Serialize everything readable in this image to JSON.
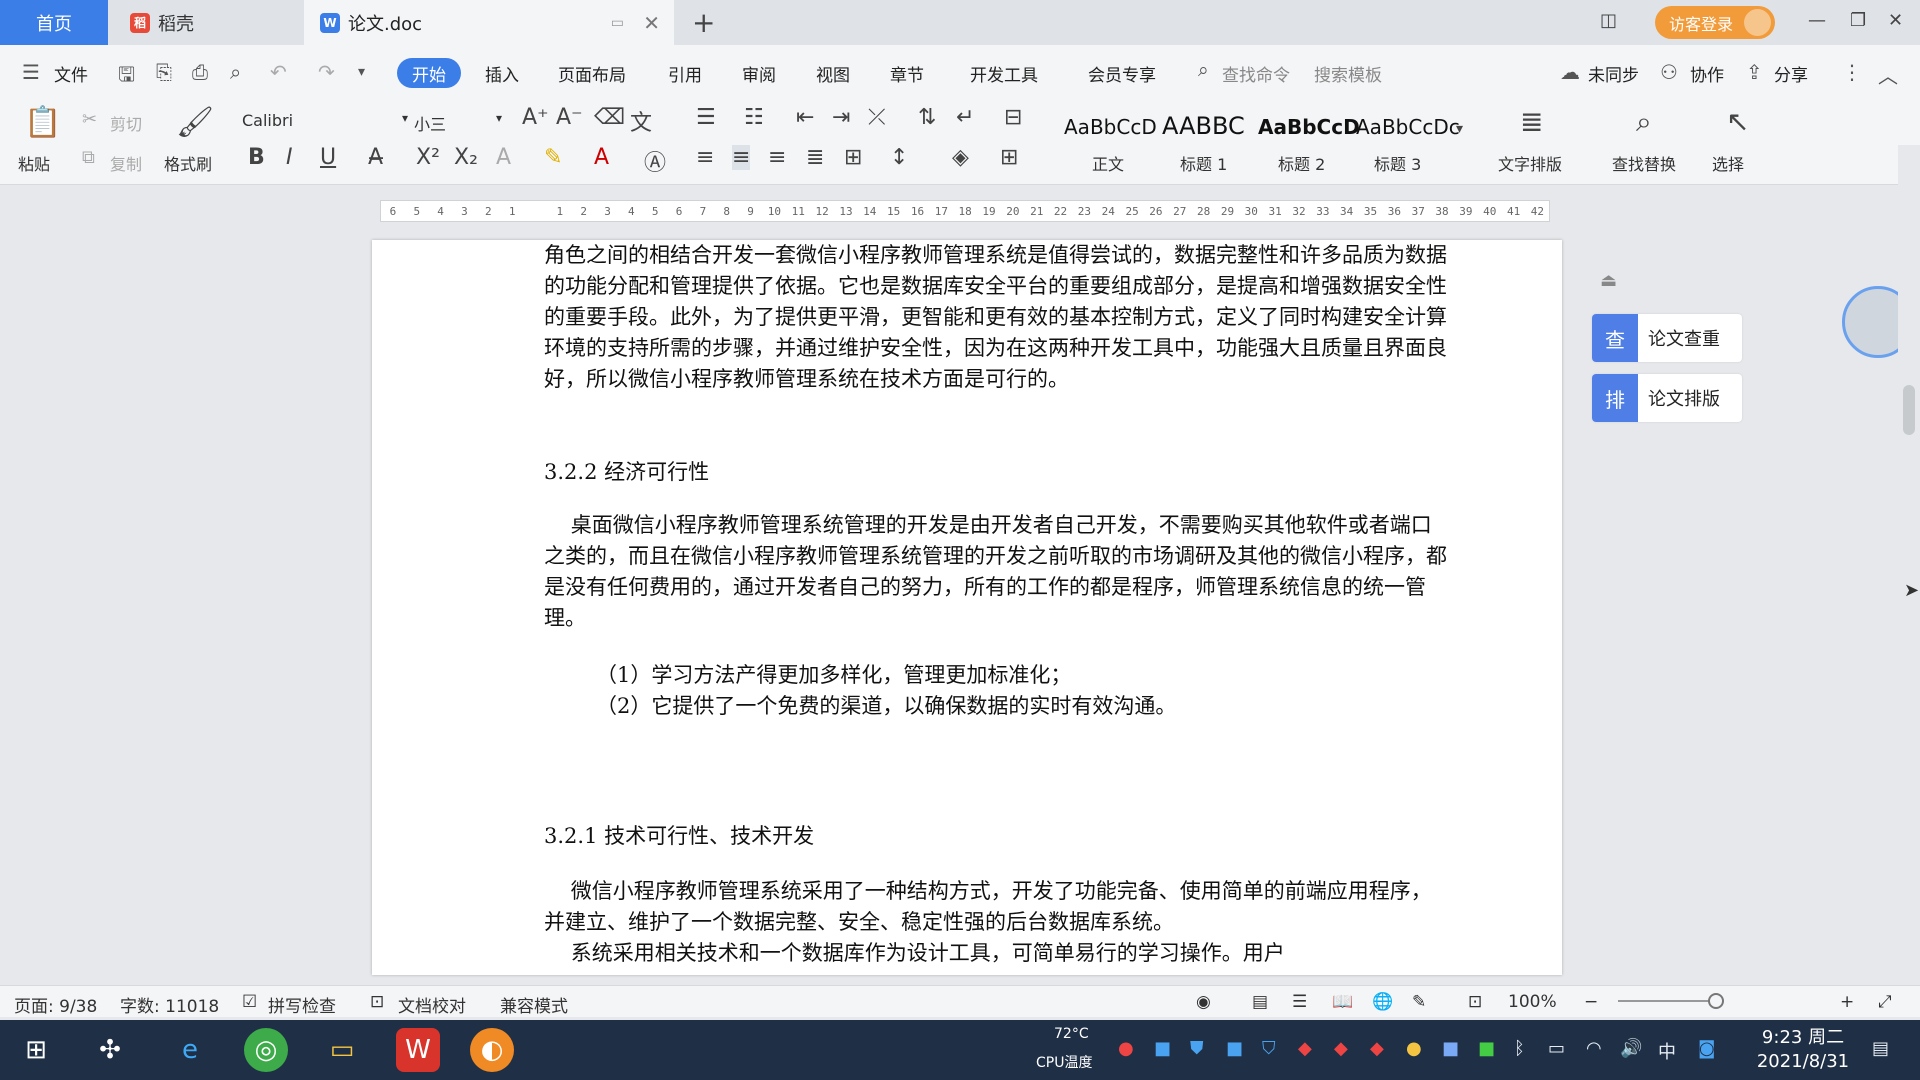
{
  "tabs": {
    "home": "首页",
    "daoke": "稻壳",
    "doc": "论文.doc",
    "login": "访客登录"
  },
  "menu": {
    "file": "文件",
    "items": [
      "开始",
      "插入",
      "页面布局",
      "引用",
      "审阅",
      "视图",
      "章节",
      "开发工具",
      "会员专享"
    ],
    "search_cmd": "查找命令",
    "search_tpl": "搜索模板",
    "unsynced": "未同步",
    "collab": "协作",
    "share": "分享"
  },
  "ribbon": {
    "paste": "粘贴",
    "cut": "剪切",
    "copy": "复制",
    "format_painter": "格式刷",
    "font": "Calibri",
    "size": "小三",
    "styles": [
      {
        "preview": "AaBbCcD",
        "name": "正文"
      },
      {
        "preview": "AABBC",
        "name": "标题 1"
      },
      {
        "preview": "AaBbCcD",
        "name": "标题 2"
      },
      {
        "preview": "AaBbCcDc",
        "name": "标题 3"
      }
    ],
    "text_layout": "文字排版",
    "find_replace": "查找替换",
    "select": "选择"
  },
  "ruler": [
    "6",
    "5",
    "4",
    "3",
    "2",
    "1",
    "",
    "1",
    "2",
    "3",
    "4",
    "5",
    "6",
    "7",
    "8",
    "9",
    "10",
    "11",
    "12",
    "13",
    "14",
    "15",
    "16",
    "17",
    "18",
    "19",
    "20",
    "21",
    "22",
    "23",
    "24",
    "25",
    "26",
    "27",
    "28",
    "29",
    "30",
    "31",
    "32",
    "33",
    "34",
    "35",
    "36",
    "37",
    "38",
    "39",
    "40",
    "41",
    "42"
  ],
  "doc": {
    "p1": "角色之间的相结合开发一套微信小程序教师管理系统是值得尝试的，数据完整性和许多品质为数据的功能分配和管理提供了依据。它也是数据库安全平台的重要组成部分，是提高和增强数据安全性的重要手段。此外，为了提供更平滑，更智能和更有效的基本控制方式，定义了同时构建安全计算环境的支持所需的步骤，并通过维护安全性，因为在这两种开发工具中，功能强大且质量且界面良好，所以微信小程序教师管理系统在技术方面是可行的。",
    "h1": "3.2.2 经济可行性",
    "p2": "    桌面微信小程序教师管理系统管理的开发是由开发者自己开发，不需要购买其他软件或者端口之类的，而且在微信小程序教师管理系统管理的开发之前听取的市场调研及其他的微信小程序，都是没有任何费用的，通过开发者自己的努力，所有的工作的都是程序，师管理系统信息的统一管理。",
    "li1": "（1）学习方法产得更加多样化，管理更加标准化；",
    "li2": "（2）它提供了一个免费的渠道，以确保数据的实时有效沟通。",
    "h2": "3.2.1 技术可行性、技术开发",
    "p3": "    微信小程序教师管理系统采用了一种结构方式，开发了功能完备、使用简单的前端应用程序，并建立、维护了一个数据完整、安全、稳定性强的后台数据库系统。",
    "p4": "    系统采用相关技术和一个数据库作为设计工具，可简单易行的学习操作。用户"
  },
  "side": {
    "check": "论文查重",
    "layout": "论文排版"
  },
  "status": {
    "page": "页面: 9/38",
    "words": "字数: 11018",
    "spell": "拼写检查",
    "proof": "文档校对",
    "compat": "兼容模式",
    "zoom": "100%"
  },
  "taskbar": {
    "temp": "72°C",
    "cpu": "CPU温度",
    "ime": "中",
    "time": "9:23 周二",
    "date": "2021/8/31"
  },
  "colors": {
    "accent": "#3b7ee8",
    "login": "#f29b3a",
    "taskbar": "#1f2f46"
  }
}
